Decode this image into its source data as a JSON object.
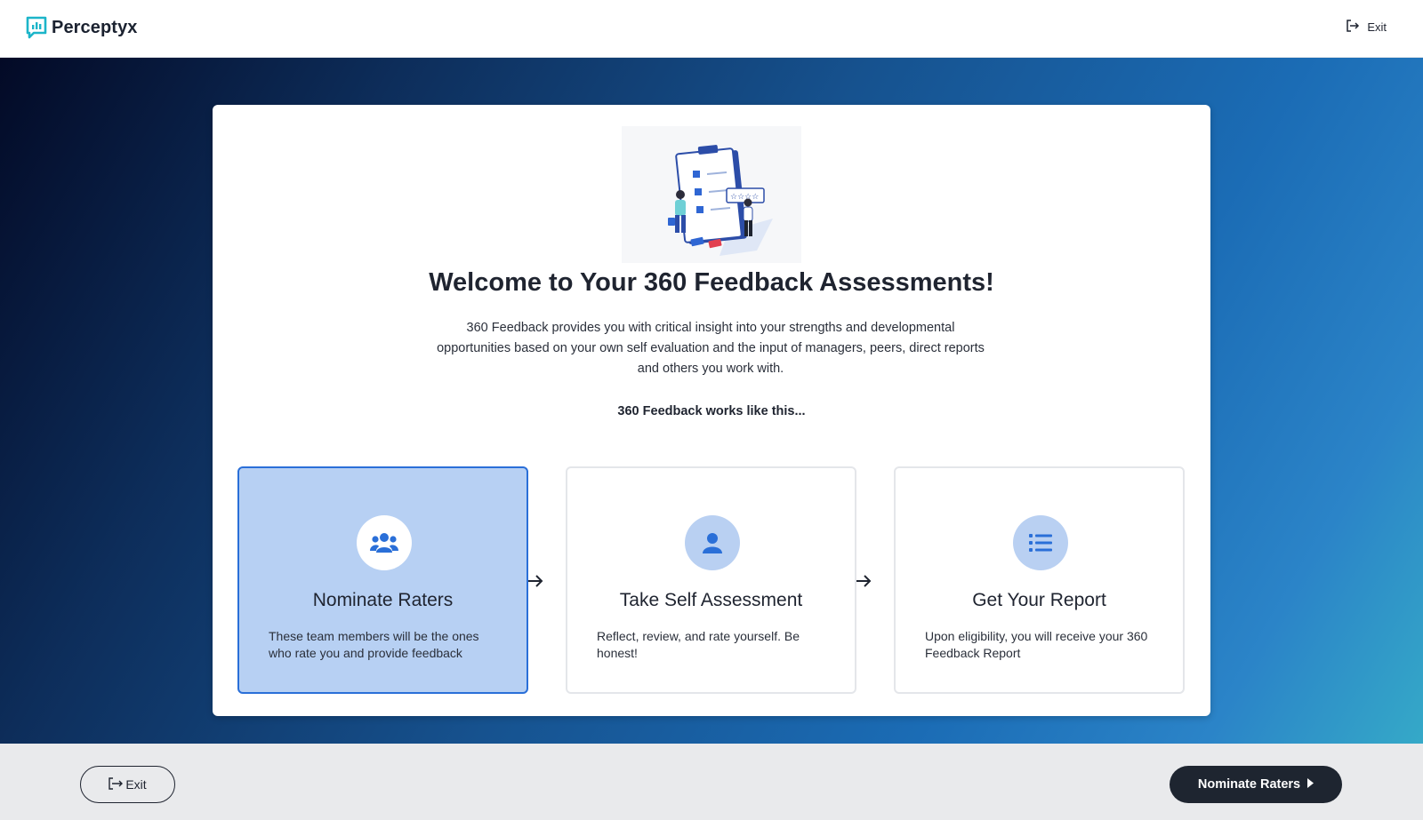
{
  "app": {
    "brand": "Perceptyx",
    "logo_icon": "chat-bars-logo-icon",
    "accent": "#1cb5c9"
  },
  "header": {
    "exit_label": "Exit",
    "exit_icon": "exit-icon"
  },
  "welcome": {
    "title": "Welcome to Your 360 Feedback Assessments!",
    "description": "360 Feedback provides you with critical insight into your strengths and developmental opportunities based on your own self evaluation and the input of managers, peers, direct reports and others you work with.",
    "works_label": "360 Feedback works like this..."
  },
  "steps": [
    {
      "title": "Nominate Raters",
      "description": "These team members will be the ones who rate you and provide feedback",
      "icon": "users-icon",
      "active": true
    },
    {
      "title": "Take Self Assessment",
      "description": "Reflect, review, and rate yourself. Be honest!",
      "icon": "user-icon",
      "active": false
    },
    {
      "title": "Get Your Report",
      "description": "Upon eligibility, you will receive your 360 Feedback Report",
      "icon": "list-icon",
      "active": false
    }
  ],
  "footer": {
    "exit_label": "Exit",
    "next_label": "Nominate Raters",
    "next_icon": "caret-right-icon"
  },
  "colors": {
    "active_card": "#b7d0f3",
    "active_border": "#2a6fd8",
    "icon_blue": "#2a6fd8",
    "dark_button": "#1e2530"
  }
}
